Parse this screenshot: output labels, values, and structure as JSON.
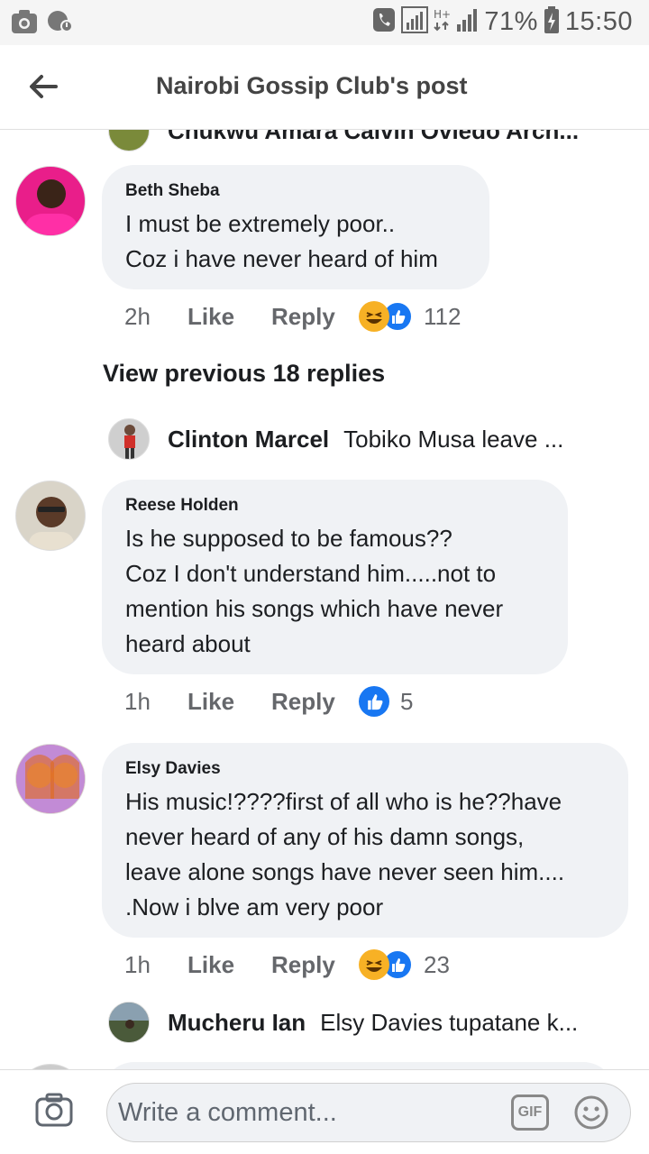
{
  "status_bar": {
    "battery": "71%",
    "time": "15:50"
  },
  "header": {
    "title": "Nairobi Gossip Club's post"
  },
  "partial_reply": {
    "text": "Chukwu Amara  Calvin Oviedo Arch..."
  },
  "comments": [
    {
      "author": "Beth Sheba",
      "lines": [
        "I must be extremely poor..",
        "Coz i have never heard of him"
      ],
      "time": "2h",
      "like": "Like",
      "reply": "Reply",
      "reactions": [
        "haha",
        "like"
      ],
      "reaction_count": "112"
    },
    {
      "author": "Reese Holden",
      "lines": [
        "Is he supposed to be famous??",
        "Coz I don't understand him.....not to",
        "mention his songs which have never",
        "heard about"
      ],
      "time": "1h",
      "like": "Like",
      "reply": "Reply",
      "reactions": [
        "like"
      ],
      "reaction_count": "5"
    },
    {
      "author": "Elsy Davies",
      "lines": [
        "His music!????first of all who is he??have",
        "never heard of any of his damn songs,",
        "leave alone songs have never seen him....",
        ".Now i blve am very poor"
      ],
      "time": "1h",
      "like": "Like",
      "reply": "Reply",
      "reactions": [
        "haha",
        "like"
      ],
      "reaction_count": "23"
    }
  ],
  "view_previous": "View previous 18 replies",
  "replies": [
    {
      "author": "Clinton Marcel",
      "text": "Tobiko Musa leave ..."
    },
    {
      "author": "Mucheru Ian",
      "text": "Elsy Davies tupatane k..."
    }
  ],
  "composer": {
    "placeholder": "Write a comment...",
    "gif_label": "GIF"
  },
  "icons": {
    "back": "arrow-left-icon",
    "camera": "camera-icon",
    "emoji": "emoji-icon"
  },
  "colors": {
    "like_blue": "#1877f2",
    "haha_yellow": "#f7b125",
    "bubble_bg": "#f0f2f5"
  }
}
